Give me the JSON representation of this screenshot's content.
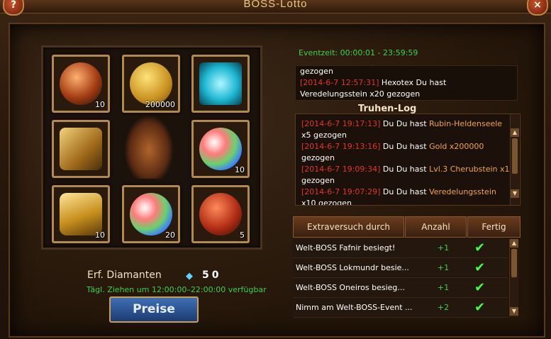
{
  "window": {
    "title": "BOSS-Lotto"
  },
  "buttons": {
    "help": "?",
    "close": "×",
    "prices": "Preise"
  },
  "slots": [
    {
      "icon": "ore-orb-icon",
      "count": "10",
      "cls": "i-ore"
    },
    {
      "icon": "gold-coin-icon",
      "count": "200000",
      "cls": "i-coin"
    },
    {
      "icon": "blue-gem-icon",
      "count": "",
      "cls": "i-gem"
    },
    {
      "icon": "claw-armor-icon",
      "count": "",
      "cls": "i-claw"
    },
    {
      "icon": "rainbow-orb-icon",
      "count": "10",
      "cls": "i-opal"
    },
    {
      "icon": "gold-shield-icon",
      "count": "10",
      "cls": "i-shield"
    },
    {
      "icon": "rainbow-orb-icon",
      "count": "20",
      "cls": "i-opal"
    },
    {
      "icon": "red-ore-orb-icon",
      "count": "5",
      "cls": "i-ore2"
    }
  ],
  "diamonds": {
    "label": "Erf. Diamanten",
    "value": "50"
  },
  "draw_time": "Tägl. Ziehen um 12:00:00–22:00:00 verfügbar",
  "event_time": "Eventzeit: 00:00:01 - 23:59:59",
  "broadcast": [
    {
      "ts": "",
      "text": "gezogen",
      "item": ""
    },
    {
      "ts": "[2014-6-7 12:57:31]",
      "text": " Hexotex Du hast",
      "item": ""
    },
    {
      "ts": "",
      "text": "Veredelungsstein x20 gezogen",
      "item": ""
    }
  ],
  "chest_log": {
    "title": "Truhen-Log",
    "lines": [
      {
        "ts": "[2014-6-7 19:17:13]",
        "who": " Du Du hast ",
        "item": "Rubin-Heldenseele"
      },
      {
        "ts": "",
        "who": "x5 gezogen",
        "item": ""
      },
      {
        "ts": "[2014-6-7 19:13:16]",
        "who": " Du Du hast ",
        "item": "Gold x200000"
      },
      {
        "ts": "",
        "who": "gezogen",
        "item": ""
      },
      {
        "ts": "[2014-6-7 19:09:34]",
        "who": " Du Du hast ",
        "item": "Lvl.3 Cherubstein x1"
      },
      {
        "ts": "",
        "who": "gezogen",
        "item": ""
      },
      {
        "ts": "[2014-6-7 19:07:29]",
        "who": " Du Du hast ",
        "item": "Veredelungsstein"
      },
      {
        "ts": "",
        "who": "x10 gezogen",
        "item": ""
      }
    ]
  },
  "extra_table": {
    "headers": [
      "Extraversuch durch",
      "Anzahl",
      "Fertig"
    ],
    "rows": [
      {
        "task": "Welt-BOSS Fafnir besiegt!",
        "amount": "+1",
        "done": "✔"
      },
      {
        "task": "Welt-BOSS Lokmundr besie...",
        "amount": "+1",
        "done": "✔"
      },
      {
        "task": "Welt-BOSS Oneiros besieg...",
        "amount": "+1",
        "done": "✔"
      },
      {
        "task": "Nimm am Welt-BOSS-Event ...",
        "amount": "+2",
        "done": "✔"
      }
    ]
  }
}
